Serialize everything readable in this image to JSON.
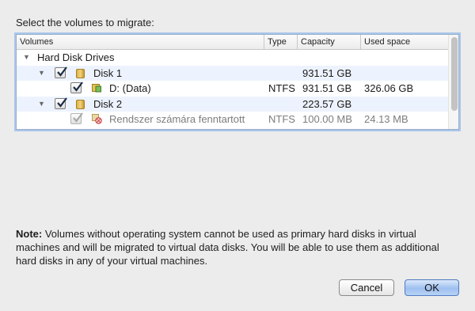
{
  "dialog": {
    "prompt": "Select the volumes to migrate:",
    "columns": {
      "volumes": "Volumes",
      "type": "Type",
      "capacity": "Capacity",
      "used": "Used space"
    },
    "rows": [
      {
        "label": "Hard Disk Drives",
        "type": "",
        "capacity": "",
        "used": "",
        "checked": null,
        "expanded": true
      },
      {
        "label": "Disk 1",
        "type": "",
        "capacity": "931.51 GB",
        "used": "",
        "checked": true,
        "expanded": true
      },
      {
        "label": "D: (Data)",
        "type": "NTFS",
        "capacity": "931.51 GB",
        "used": "326.06 GB",
        "checked": true
      },
      {
        "label": "Disk 2",
        "type": "",
        "capacity": "223.57 GB",
        "used": "",
        "checked": true,
        "expanded": true
      },
      {
        "label": "Rendszer számára fenntartott",
        "type": "NTFS",
        "capacity": "100.00 MB",
        "used": "24.13 MB",
        "checked": true,
        "disabled": true
      }
    ],
    "note": {
      "label": "Note:",
      "text": "Volumes without operating system cannot be used as primary hard disks in virtual machines and will be migrated to virtual data disks. You will be able to use them as additional hard disks in any of your virtual machines."
    },
    "buttons": {
      "cancel": "Cancel",
      "ok": "OK"
    },
    "colors": {
      "selection_border": "#a9c6ec",
      "alt_row": "#edf3fe",
      "ok_button": "#9ec0f0"
    }
  }
}
